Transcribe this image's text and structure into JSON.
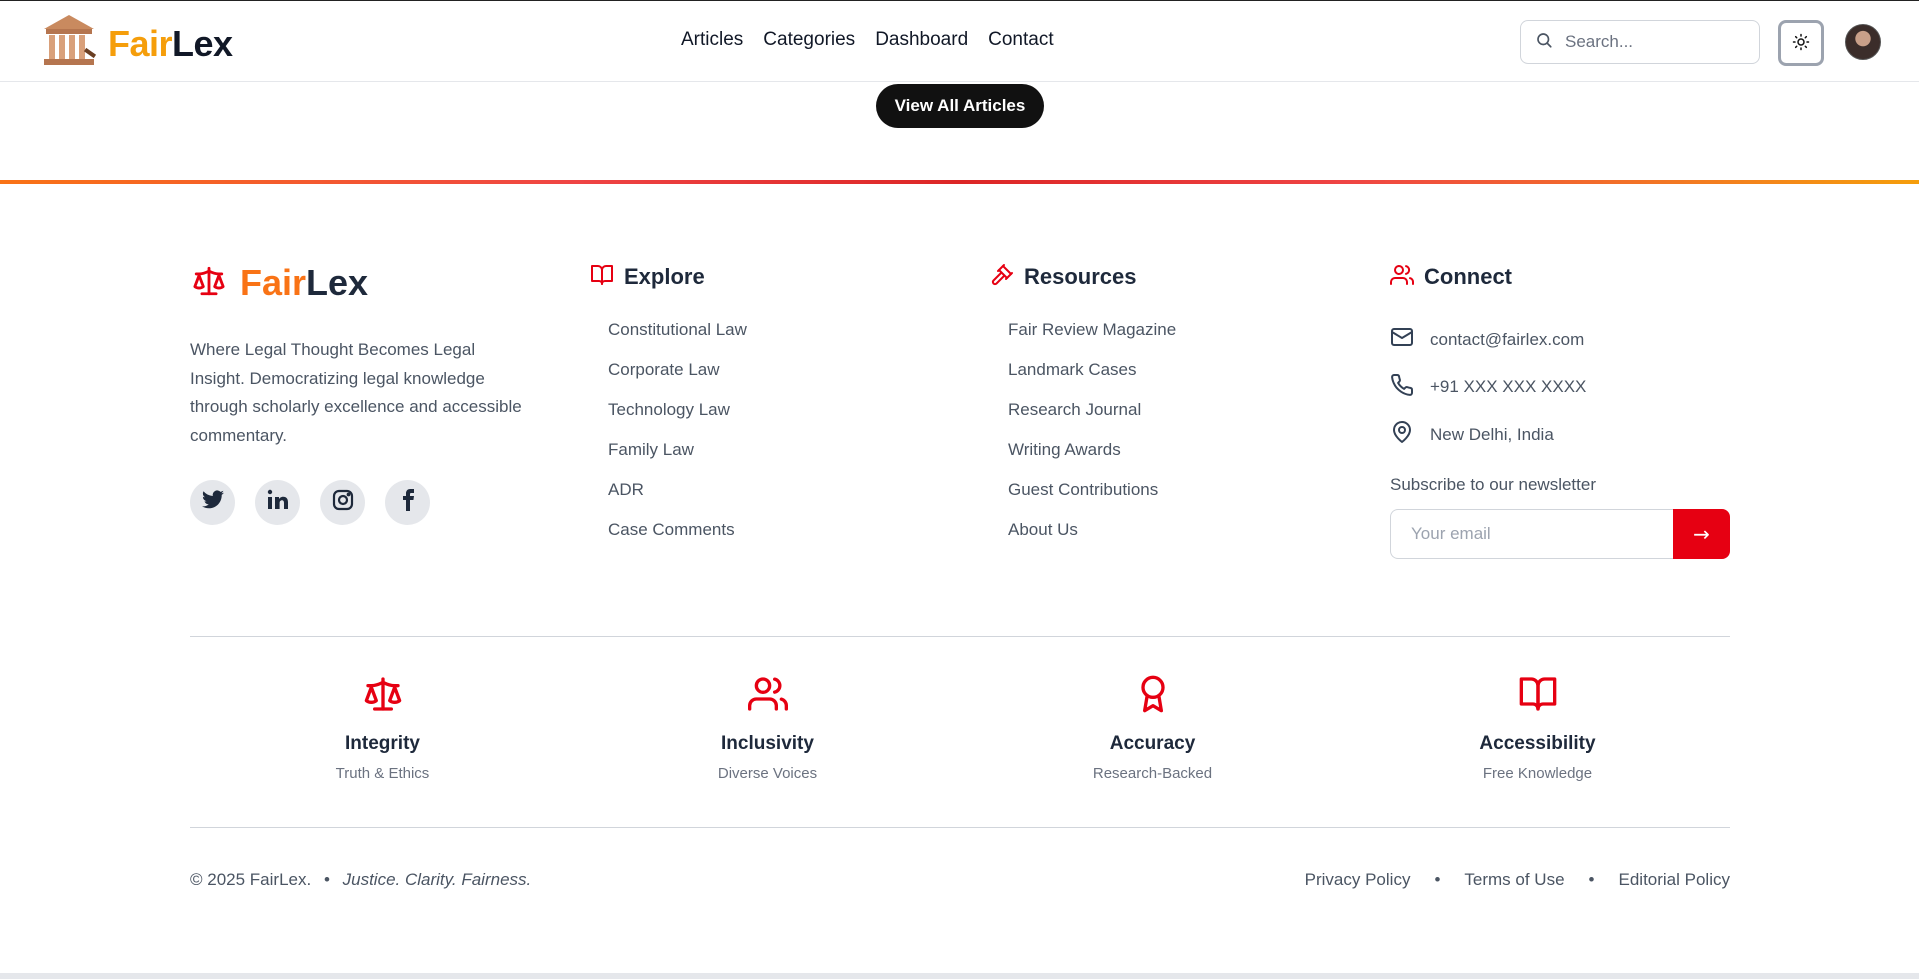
{
  "header": {
    "brand_fair": "Fair",
    "brand_lex": "Lex",
    "nav": [
      "Articles",
      "Categories",
      "Dashboard",
      "Contact"
    ],
    "search_placeholder": "Search..."
  },
  "cta": {
    "view_all": "View All Articles"
  },
  "footer": {
    "brand_fair": "Fair",
    "brand_lex": "Lex",
    "tagline": "Where Legal Thought Becomes Legal Insight. Democratizing legal knowledge through scholarly excellence and accessible commentary.",
    "socials": [
      "twitter-icon",
      "linkedin-icon",
      "instagram-icon",
      "facebook-icon"
    ],
    "explore": {
      "title": "Explore",
      "links": [
        "Constitutional Law",
        "Corporate Law",
        "Technology Law",
        "Family Law",
        "ADR",
        "Case Comments"
      ]
    },
    "resources": {
      "title": "Resources",
      "links": [
        "Fair Review Magazine",
        "Landmark Cases",
        "Research Journal",
        "Writing Awards",
        "Guest Contributions",
        "About Us"
      ]
    },
    "connect": {
      "title": "Connect",
      "email": "contact@fairlex.com",
      "phone": "+91 XXX XXX XXXX",
      "location": "New Delhi, India",
      "subscribe_label": "Subscribe to our newsletter",
      "email_placeholder": "Your email",
      "submit_label": "→"
    },
    "values": [
      {
        "title": "Integrity",
        "subtitle": "Truth & Ethics",
        "icon": "scale-icon"
      },
      {
        "title": "Inclusivity",
        "subtitle": "Diverse Voices",
        "icon": "users-icon"
      },
      {
        "title": "Accuracy",
        "subtitle": "Research-Backed",
        "icon": "award-icon"
      },
      {
        "title": "Accessibility",
        "subtitle": "Free Knowledge",
        "icon": "book-open-icon"
      }
    ],
    "copyright": "© 2025 FairLex.",
    "separator": "•",
    "motto": "Justice. Clarity. Fairness.",
    "policies": [
      "Privacy Policy",
      "Terms of Use",
      "Editorial Policy"
    ]
  },
  "colors": {
    "accent": "#e60012",
    "brand_orange": "#f59e0b",
    "dark_button": "#111111"
  }
}
